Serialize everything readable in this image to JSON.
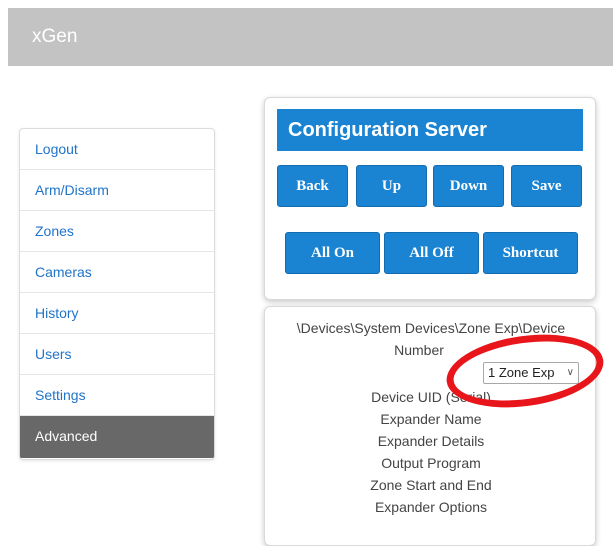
{
  "app": {
    "title": "xGen"
  },
  "sidebar": {
    "items": [
      {
        "label": "Logout"
      },
      {
        "label": "Arm/Disarm"
      },
      {
        "label": "Zones"
      },
      {
        "label": "Cameras"
      },
      {
        "label": "History"
      },
      {
        "label": "Users"
      },
      {
        "label": "Settings"
      },
      {
        "label": "Advanced",
        "active": true
      }
    ]
  },
  "config": {
    "title": "Configuration Server",
    "buttons_row1": [
      "Back",
      "Up",
      "Down",
      "Save"
    ],
    "buttons_row2": [
      "All On",
      "All Off",
      "Shortcut"
    ]
  },
  "details": {
    "path": "\\Devices\\System Devices\\Zone Exp\\Device",
    "number_label": "Number",
    "number_select_value": "1 Zone Exp",
    "fields": [
      "Device UID (Serial)",
      "Expander Name",
      "Expander Details",
      "Output Program",
      "Zone Start and End",
      "Expander Options"
    ]
  },
  "annotation": {
    "color": "#e8151b"
  },
  "colors": {
    "accent": "#1a83d2",
    "link": "#1f73c8",
    "active_nav": "#686868",
    "topbar": "#c3c3c3"
  }
}
